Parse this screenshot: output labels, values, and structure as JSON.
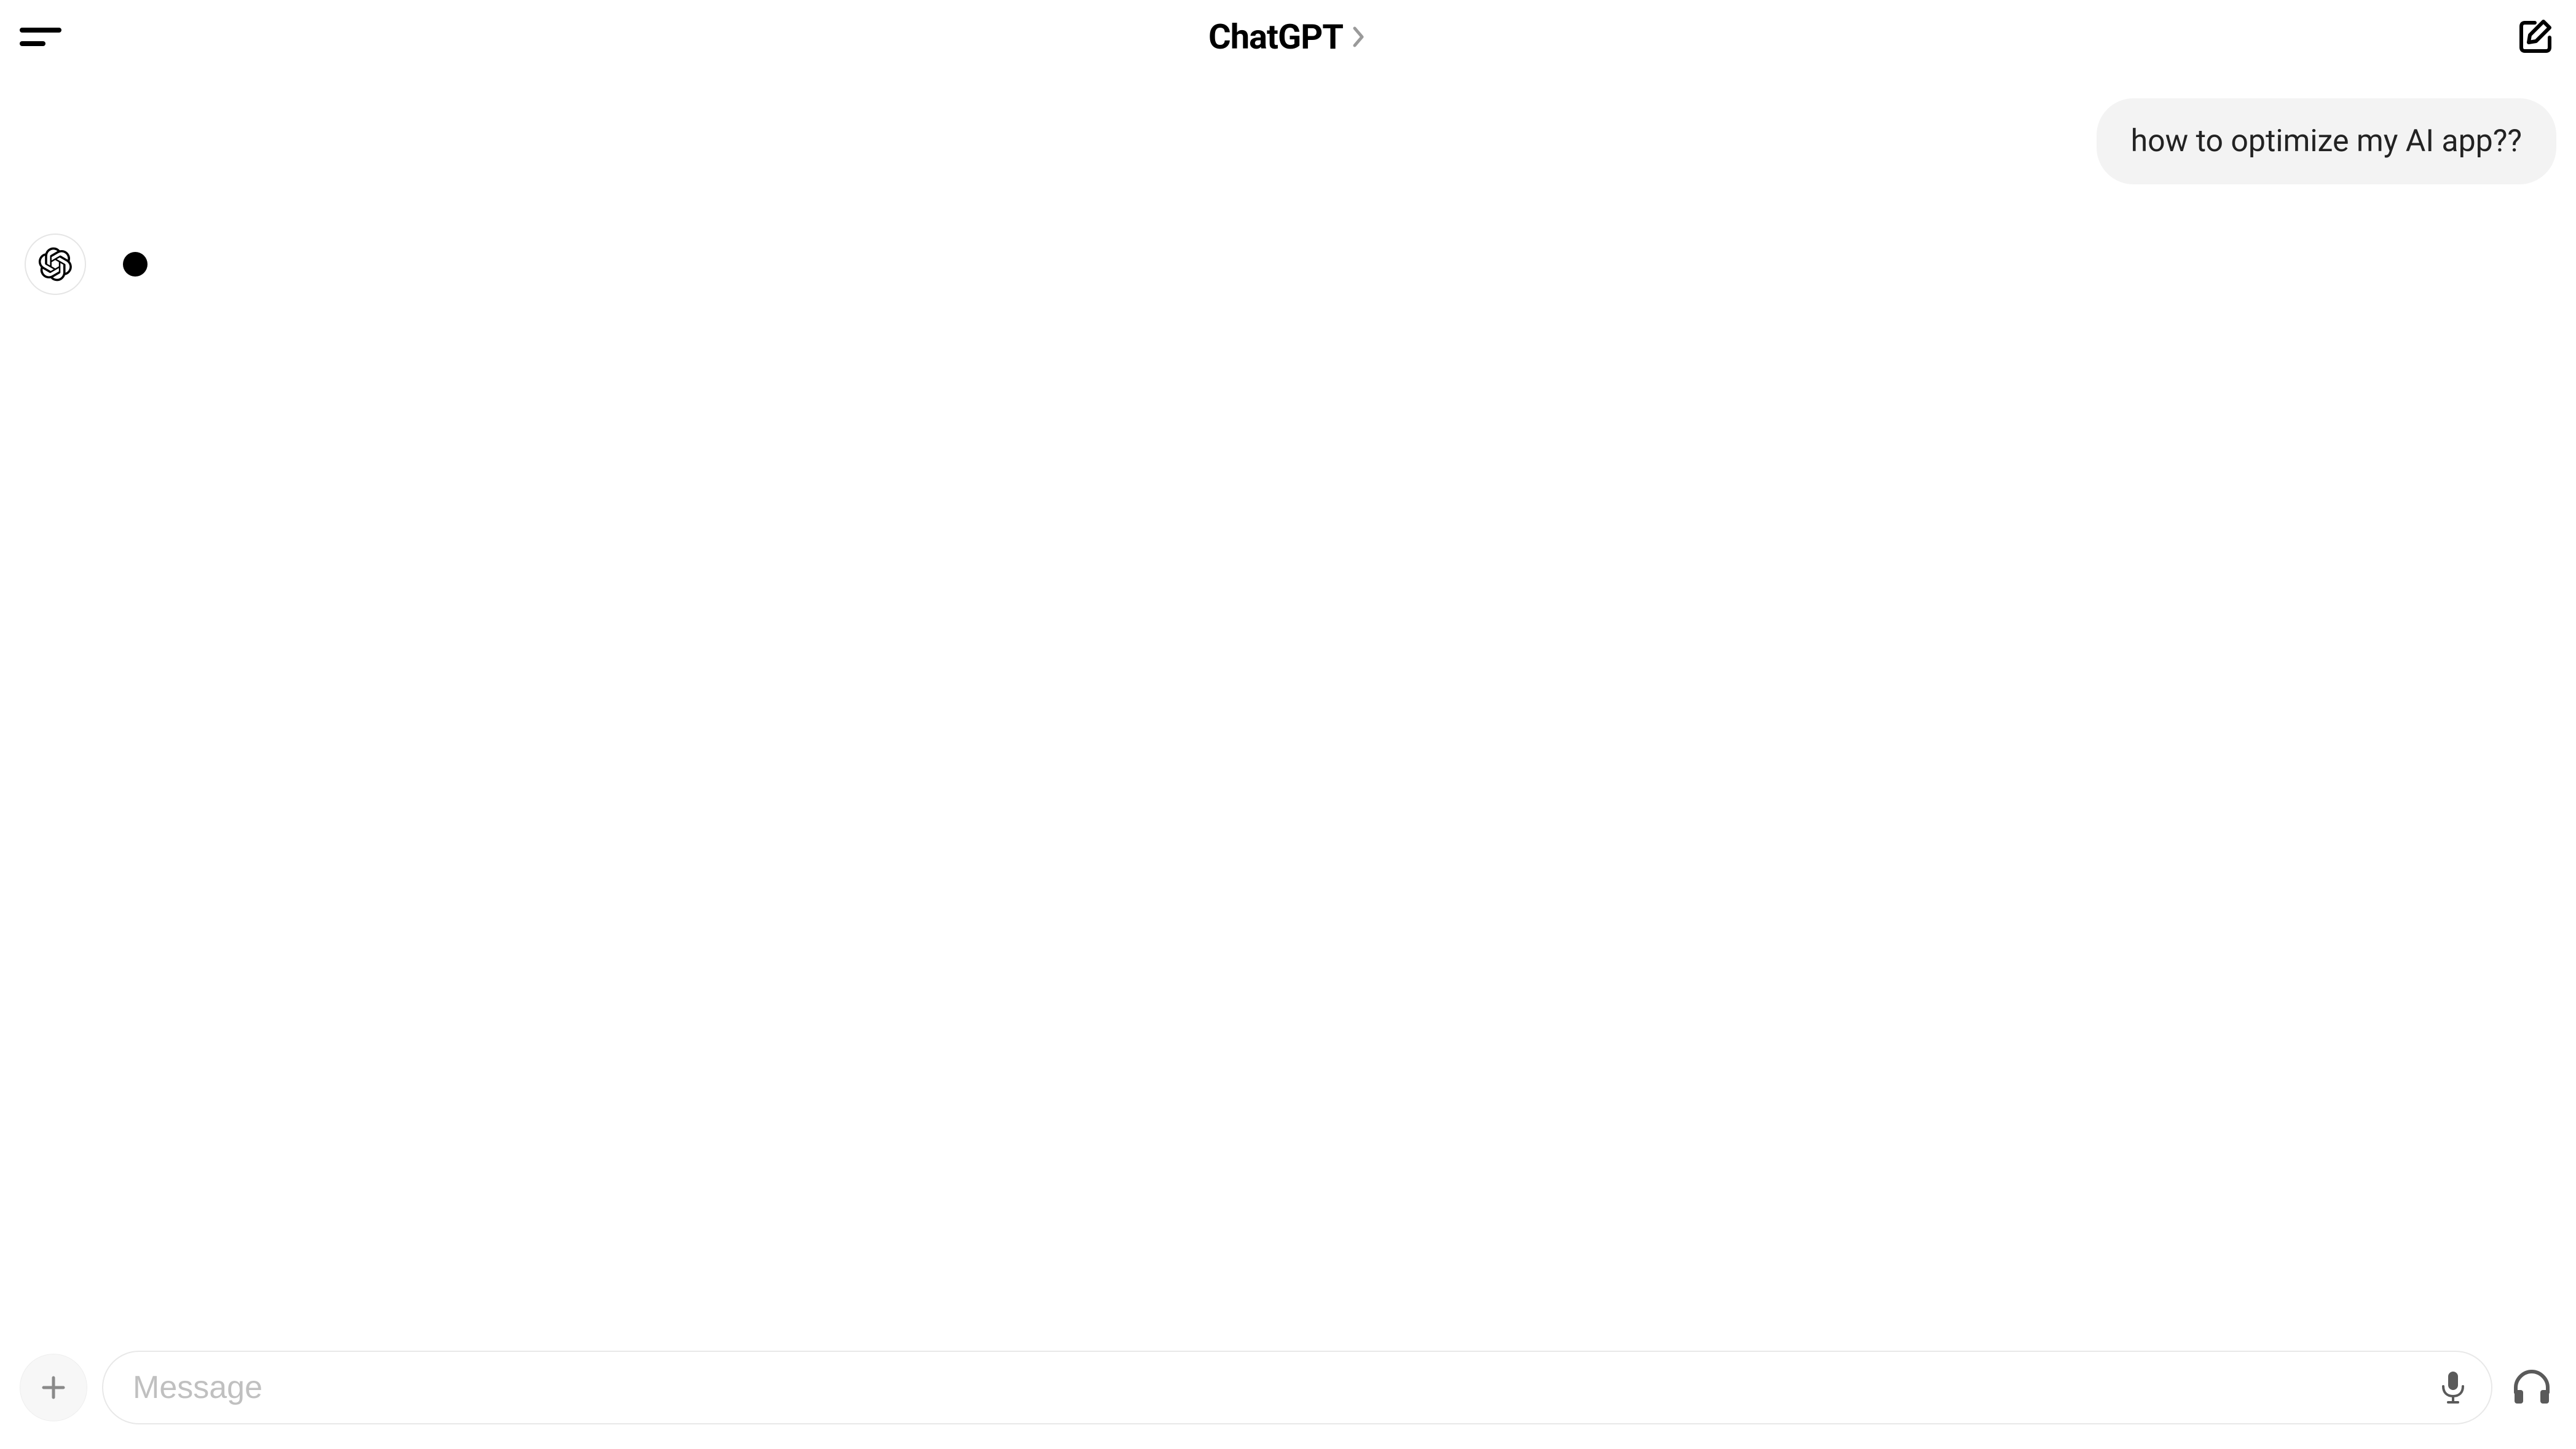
{
  "header": {
    "title": "ChatGPT"
  },
  "conversation": {
    "user_message": "how to optimize my AI app??"
  },
  "input": {
    "placeholder": "Message"
  }
}
